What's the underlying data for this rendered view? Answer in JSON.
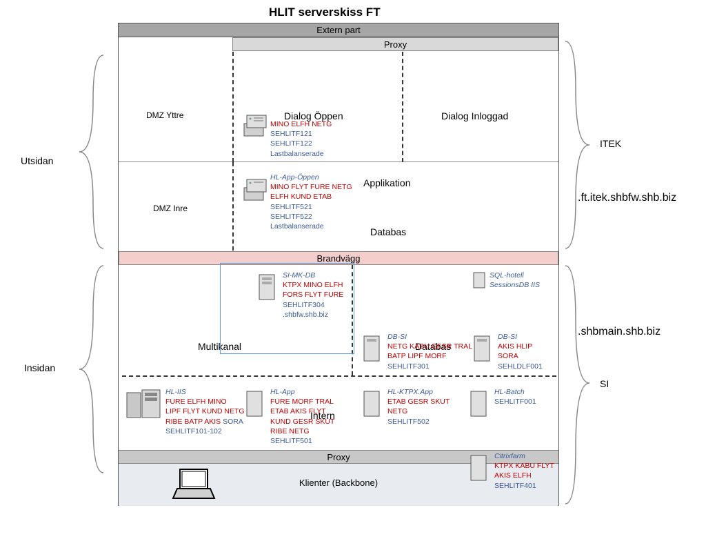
{
  "title": "HLIT serverskiss FT",
  "headers": {
    "extern": "Extern part",
    "proxy1": "Proxy",
    "brandvagg": "Brandvägg",
    "proxy2": "Proxy",
    "klienter": "Klienter (Backbone)"
  },
  "zones": {
    "dmz_yttre": "DMZ Yttre",
    "dmz_inre": "DMZ Inre",
    "dialog_oppen": "Dialog Öppen",
    "dialog_inloggad": "Dialog Inloggad",
    "applikation": "Applikation",
    "databas": "Databas",
    "multikanal": "Multikanal",
    "databas2": "Databas",
    "intern": "Intern"
  },
  "side_labels": {
    "utsidan": "Utsidan",
    "insidan": "Insidan",
    "itek": "ITEK",
    "si": "SI",
    "domain1": ".ft.itek.shbfw.shb.biz",
    "domain2": ".shbmain.shb.biz"
  },
  "servers": {
    "dialog_oppen": {
      "lines": [
        "MINO ELFH NETG",
        "SEHLITF121",
        "SEHLITF122",
        "Lastbalanserade"
      ],
      "classes": [
        "red",
        "blue",
        "blue",
        "blue"
      ]
    },
    "hl_app_oppen": {
      "title": "HL-App-Öppen",
      "lines": [
        "MINO FLYT  FURE NETG",
        "ELFH KUND ETAB",
        "SEHLITF521",
        "SEHLITF522",
        "Lastbalanserade"
      ],
      "classes": [
        "red",
        "red",
        "blue",
        "blue",
        "blue"
      ]
    },
    "si_mk_db": {
      "title": "SI-MK-DB",
      "lines": [
        "KTPX MINO ELFH",
        "FORS FLYT FURE",
        "SEHLITF304",
        ".shbfw.shb.biz"
      ],
      "classes": [
        "red",
        "red",
        "blue",
        "blue"
      ]
    },
    "sql_hotell": {
      "title": "SQL-hotell",
      "lines": [
        "SessionsDB IIS"
      ],
      "classes": [
        "title-line"
      ]
    },
    "db_si_1": {
      "title": "DB-SI",
      "lines": [
        "NETG KABU GESR TRAL",
        "BATP LIPF  MORF",
        "SEHLITF301"
      ],
      "classes": [
        "red",
        "red",
        "blue"
      ]
    },
    "db_si_2": {
      "title": "DB-SI",
      "lines": [
        "AKIS  HLIP",
        "SORA",
        "SEHLDLF001"
      ],
      "classes": [
        "red",
        "red",
        "blue"
      ]
    },
    "hl_iis": {
      "title": "HL-IIS",
      "lines": [
        "FURE  ELFH MINO",
        "LIPF FLYT KUND NETG",
        "RIBE BATP AKIS SORA",
        "SEHLITF101-102"
      ],
      "classes": [
        "red",
        "red",
        "red blue",
        "blue"
      ]
    },
    "hl_app": {
      "title": "HL-App",
      "lines": [
        "FURE MORF TRAL",
        "ETAB AKIS FLYT",
        "KUND GESR SKUT",
        "RIBE  NETG",
        "SEHLITF501"
      ],
      "classes": [
        "red",
        "red",
        "red",
        "red",
        "blue"
      ]
    },
    "hl_ktpx": {
      "title": "HL-KTPX.App",
      "lines": [
        "ETAB GESR SKUT",
        "NETG",
        "SEHLITF502"
      ],
      "classes": [
        "red",
        "red",
        "blue"
      ]
    },
    "hl_batch": {
      "title": "HL-Batch",
      "lines": [
        "SEHLITF001"
      ],
      "classes": [
        "blue"
      ]
    },
    "citrix": {
      "title": "Citrixfarm",
      "lines": [
        "KTPX KABU FLYT",
        "AKIS ELFH",
        "SEHLITF401"
      ],
      "classes": [
        "red",
        "red",
        "blue"
      ]
    }
  }
}
